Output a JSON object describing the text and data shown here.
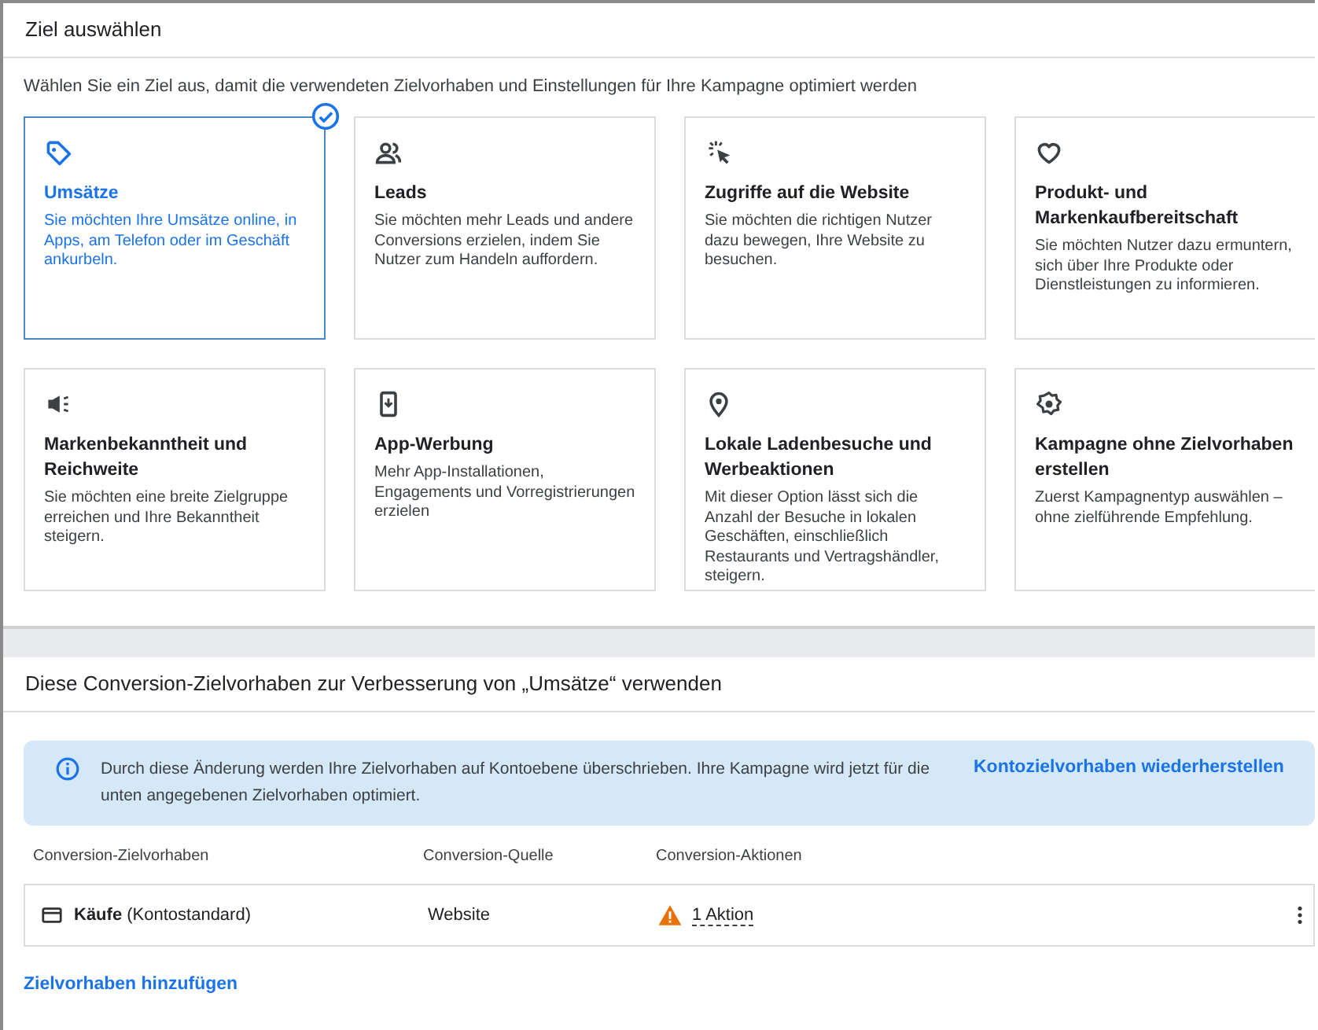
{
  "goal_section": {
    "title": "Ziel auswählen",
    "intro": "Wählen Sie ein Ziel aus, damit die verwendeten Zielvorhaben und Einstellungen für Ihre Kampagne optimiert werden",
    "cards": [
      {
        "title": "Umsätze",
        "description": "Sie möchten Ihre Umsätze online, in Apps, am Telefon oder im Geschäft ankurbeln.",
        "selected": true
      },
      {
        "title": "Leads",
        "description": "Sie möchten mehr Leads und andere Conversions erzielen, indem Sie Nutzer zum Handeln auffordern.",
        "selected": false
      },
      {
        "title": "Zugriffe auf die Website",
        "description": "Sie möchten die richtigen Nutzer dazu bewegen, Ihre Website zu besuchen.",
        "selected": false
      },
      {
        "title": "Produkt- und Markenkaufbereitschaft",
        "description": "Sie möchten Nutzer dazu ermuntern, sich über Ihre Produkte oder Dienstleistungen zu informieren.",
        "selected": false
      },
      {
        "title": "Markenbekanntheit und Reichweite",
        "description": "Sie möchten eine breite Zielgruppe erreichen und Ihre Bekanntheit steigern.",
        "selected": false
      },
      {
        "title": "App-Werbung",
        "description": "Mehr App-Installationen, Engagements und Vorregistrierungen erzielen",
        "selected": false
      },
      {
        "title": "Lokale Ladenbesuche und Werbeaktionen",
        "description": "Mit dieser Option lässt sich die Anzahl der Besuche in lokalen Geschäften, einschließlich Restaurants und Vertragshändler, steigern.",
        "selected": false
      },
      {
        "title": "Kampagne ohne Zielvorhaben erstellen",
        "description": "Zuerst Kampagnentyp auswählen – ohne zielführende Empfehlung.",
        "selected": false
      }
    ]
  },
  "conversion_section": {
    "title": "Diese Conversion-Zielvorhaben zur Verbesserung von „Umsätze“ verwenden",
    "notice": {
      "text": "Durch diese Änderung werden Ihre Zielvorhaben auf Kontoebene überschrieben. Ihre Kampagne wird jetzt für die unten angegebenen Zielvorhaben optimiert.",
      "link": "Kontozielvorhaben wiederherstellen"
    },
    "table": {
      "columns": [
        "Conversion-Zielvorhaben",
        "Conversion-Quelle",
        "Conversion-Aktionen"
      ],
      "rows": [
        {
          "goal": "**Käufe** (Kontostandard)",
          "source": "Website",
          "actions": "1 Aktion",
          "warning": true
        }
      ]
    },
    "add_link": "Zielvorhaben hinzufügen"
  }
}
